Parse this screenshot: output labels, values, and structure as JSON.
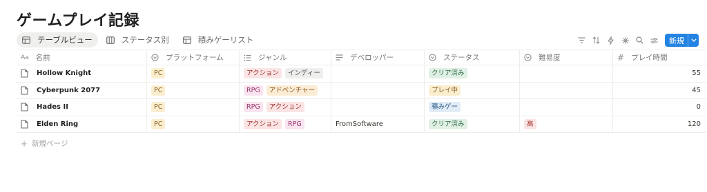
{
  "page": {
    "title": "ゲームプレイ記録"
  },
  "views": [
    {
      "label": "テーブルビュー",
      "icon": "table-icon",
      "active": true
    },
    {
      "label": "ステータス別",
      "icon": "board-icon",
      "active": false
    },
    {
      "label": "積みゲーリスト",
      "icon": "table-icon",
      "active": false
    }
  ],
  "toolbar": {
    "icons": [
      "filter-icon",
      "sort-icon",
      "automation-icon",
      "ai-icon",
      "search-icon",
      "settings-icon"
    ],
    "new_label": "新規"
  },
  "columns": [
    {
      "label": "名前",
      "icon": "title-icon"
    },
    {
      "label": "プラットフォーム",
      "icon": "select-icon"
    },
    {
      "label": "ジャンル",
      "icon": "multiselect-icon"
    },
    {
      "label": "デベロッパー",
      "icon": "text-icon"
    },
    {
      "label": "ステータス",
      "icon": "select-icon"
    },
    {
      "label": "難易度",
      "icon": "select-icon"
    },
    {
      "label": "プレイ時間",
      "icon": "number-icon"
    }
  ],
  "rows": [
    {
      "name": "Hollow Knight",
      "platform": "PC",
      "genres": [
        "アクション",
        "インディー"
      ],
      "developer": "",
      "status": "クリア済み",
      "difficulty": "",
      "playtime": "55"
    },
    {
      "name": "Cyberpunk 2077",
      "platform": "PC",
      "genres": [
        "RPG",
        "アドベンチャー"
      ],
      "developer": "",
      "status": "プレイ中",
      "difficulty": "",
      "playtime": "45"
    },
    {
      "name": "Hades II",
      "platform": "PC",
      "genres": [
        "RPG",
        "アクション"
      ],
      "developer": "",
      "status": "積みゲー",
      "difficulty": "",
      "playtime": "0"
    },
    {
      "name": "Elden Ring",
      "platform": "PC",
      "genres": [
        "アクション",
        "RPG"
      ],
      "developer": "FromSoftware",
      "status": "クリア済み",
      "difficulty": "高",
      "playtime": "120"
    }
  ],
  "tag_colors": {
    "PC": {
      "bg": "#fbeecf",
      "fg": "#89632a"
    },
    "アクション": {
      "bg": "#fbe4e4",
      "fg": "#9f2f2d"
    },
    "インディー": {
      "bg": "#eeeeed",
      "fg": "#4a4a47"
    },
    "RPG": {
      "bg": "#f9e4ef",
      "fg": "#9c3970"
    },
    "アドベンチャー": {
      "bg": "#fbecd6",
      "fg": "#8a5318"
    },
    "クリア済み": {
      "bg": "#e1f0e5",
      "fg": "#2d6a44"
    },
    "プレイ中": {
      "bg": "#fbeecf",
      "fg": "#89632a"
    },
    "積みゲー": {
      "bg": "#e1ecf7",
      "fg": "#2b5a85"
    },
    "高": {
      "bg": "#fbe4e4",
      "fg": "#9f2f2d"
    }
  },
  "new_page": {
    "label": "新規ページ"
  },
  "colors": {
    "accent": "#2383e2",
    "border": "#ededec",
    "muted": "#787774"
  }
}
